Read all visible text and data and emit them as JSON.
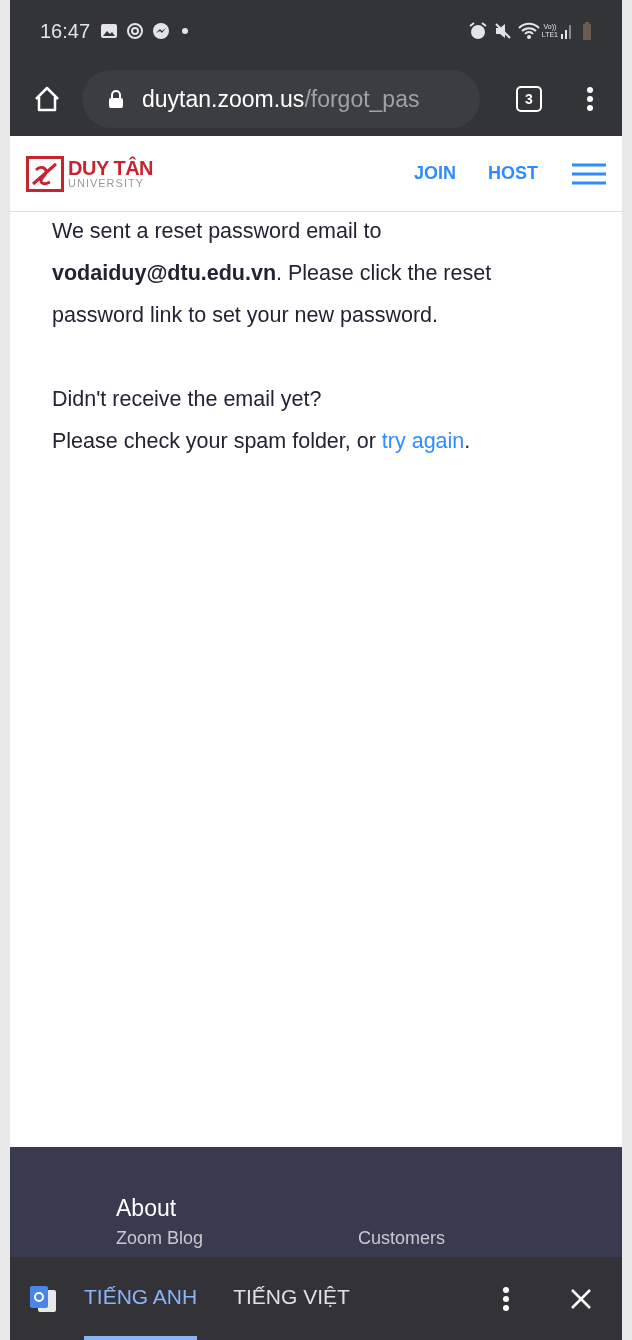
{
  "status_bar": {
    "time": "16:47",
    "network": "Vo))\nLTE1"
  },
  "address_bar": {
    "host": "duytan.zoom.us",
    "path": "/forgot_pas",
    "tab_count": "3"
  },
  "site_header": {
    "logo_name": "DUY TÂN",
    "logo_sub": "UNIVERSITY",
    "nav": [
      "JOIN",
      "HOST"
    ]
  },
  "message": "We sent a reset password email to **vodaiduy@dtu.edu.vn**. Please click the reset password link to set your new password.",
  "question": "Didn't receive the email yet?",
  "help": {
    "before": "Please check your spam folder, or ",
    "link": "try again",
    "after": "."
  },
  "footer": {
    "heading": "About",
    "links": [
      "Zoom Blog",
      "Customers"
    ]
  },
  "translate_bar": {
    "languages": [
      {
        "label": "TIẾNG ANH",
        "selected": true
      },
      {
        "label": "TIẾNG VIỆT",
        "selected": false
      }
    ]
  }
}
